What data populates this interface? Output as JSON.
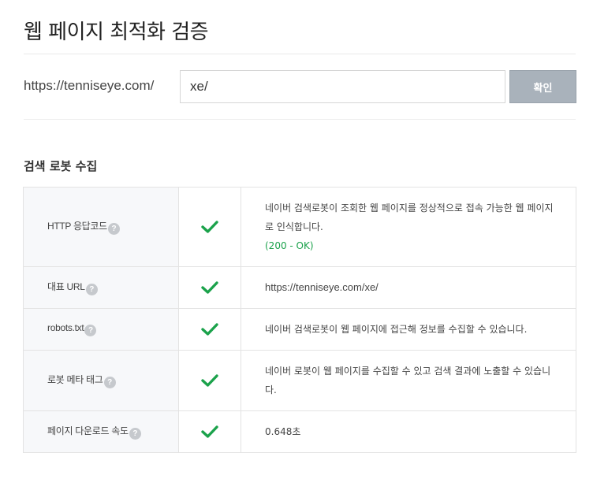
{
  "page_title": "웹 페이지 최적화 검증",
  "url_check": {
    "prefix": "https://tenniseye.com/",
    "input_value": "xe/",
    "confirm_label": "확인"
  },
  "section_title": "검색 로봇 수집",
  "colors": {
    "check": "#1ba24b",
    "button_bg": "#a9b2bb"
  },
  "rows": [
    {
      "label": "HTTP 응답코드",
      "status_icon": "check-icon",
      "description": "네이버 검색로봇이 조회한 웹 페이지를 정상적으로 접속 가능한 웹 페이지로 인식합니다.",
      "status": "(200 - OK)"
    },
    {
      "label": "대표 URL",
      "status_icon": "check-icon",
      "description": "https://tenniseye.com/xe/"
    },
    {
      "label": "robots.txt",
      "status_icon": "check-icon",
      "description": "네이버 검색로봇이 웹 페이지에 접근해 정보를 수집할 수 있습니다."
    },
    {
      "label": "로봇 메타 태그",
      "status_icon": "check-icon",
      "description": "네이버 로봇이 웹 페이지를 수집할 수 있고 검색 결과에 노출할 수 있습니다."
    },
    {
      "label": "페이지 다운로드 속도",
      "status_icon": "check-icon",
      "description": "0.648초"
    }
  ]
}
